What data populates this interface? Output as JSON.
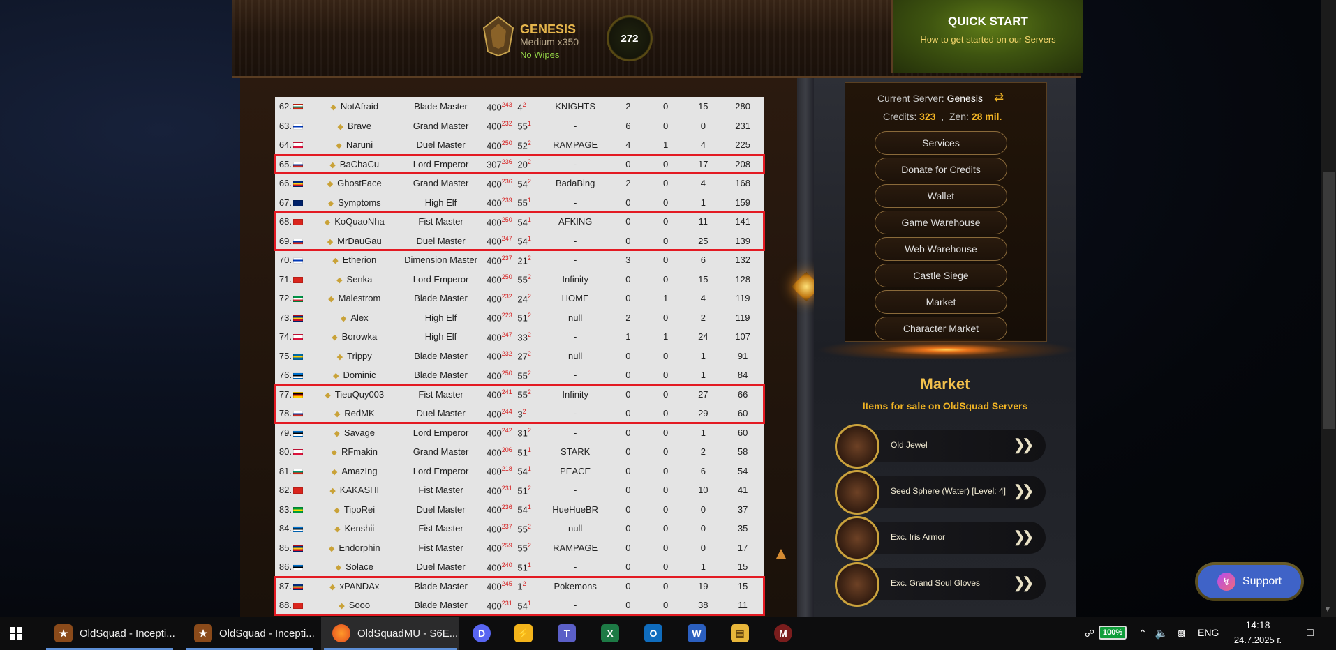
{
  "header": {
    "server_name": "GENESIS",
    "server_rate": "Medium x350",
    "server_wipe": "No Wipes",
    "online_count": "272",
    "quick_start_title": "QUICK START",
    "quick_start_sub": "How to get started on our Servers"
  },
  "ranking": {
    "rows": [
      {
        "rank": "62.",
        "flag": "bg",
        "name": "NotAfraid",
        "cls": "Blade Master",
        "reset": "400",
        "reset_sup": "243",
        "gr": "4",
        "gr_sup": "2",
        "guild": "KNIGHTS",
        "n1": "2",
        "n2": "0",
        "n3": "15",
        "score": "280"
      },
      {
        "rank": "63.",
        "flag": "il",
        "name": "Brave",
        "cls": "Grand Master",
        "reset": "400",
        "reset_sup": "232",
        "gr": "55",
        "gr_sup": "1",
        "guild": "-",
        "n1": "6",
        "n2": "0",
        "n3": "0",
        "score": "231"
      },
      {
        "rank": "64.",
        "flag": "pl",
        "name": "Naruni",
        "cls": "Duel Master",
        "reset": "400",
        "reset_sup": "250",
        "gr": "52",
        "gr_sup": "2",
        "guild": "RAMPAGE",
        "n1": "4",
        "n2": "1",
        "n3": "4",
        "score": "225"
      },
      {
        "rank": "65.",
        "flag": "ru",
        "name": "BaChaCu",
        "cls": "Lord Emperor",
        "reset": "307",
        "reset_sup": "236",
        "gr": "20",
        "gr_sup": "2",
        "guild": "-",
        "n1": "0",
        "n2": "0",
        "n3": "17",
        "score": "208"
      },
      {
        "rank": "66.",
        "flag": "ro",
        "name": "GhostFace",
        "cls": "Grand Master",
        "reset": "400",
        "reset_sup": "236",
        "gr": "54",
        "gr_sup": "2",
        "guild": "BadaBing",
        "n1": "2",
        "n2": "0",
        "n3": "4",
        "score": "168"
      },
      {
        "rank": "67.",
        "flag": "au",
        "name": "Symptoms",
        "cls": "High Elf",
        "reset": "400",
        "reset_sup": "239",
        "gr": "55",
        "gr_sup": "1",
        "guild": "-",
        "n1": "0",
        "n2": "0",
        "n3": "1",
        "score": "159"
      },
      {
        "rank": "68.",
        "flag": "vn",
        "name": "KoQuaoNha",
        "cls": "Fist Master",
        "reset": "400",
        "reset_sup": "250",
        "gr": "54",
        "gr_sup": "1",
        "guild": "AFKING",
        "n1": "0",
        "n2": "0",
        "n3": "11",
        "score": "141"
      },
      {
        "rank": "69.",
        "flag": "ru",
        "name": "MrDauGau",
        "cls": "Duel Master",
        "reset": "400",
        "reset_sup": "247",
        "gr": "54",
        "gr_sup": "1",
        "guild": "-",
        "n1": "0",
        "n2": "0",
        "n3": "25",
        "score": "139"
      },
      {
        "rank": "70.",
        "flag": "il",
        "name": "Etherion",
        "cls": "Dimension Master",
        "reset": "400",
        "reset_sup": "237",
        "gr": "21",
        "gr_sup": "2",
        "guild": "-",
        "n1": "3",
        "n2": "0",
        "n3": "6",
        "score": "132"
      },
      {
        "rank": "71.",
        "flag": "vn",
        "name": "Senka",
        "cls": "Lord Emperor",
        "reset": "400",
        "reset_sup": "250",
        "gr": "55",
        "gr_sup": "2",
        "guild": "Infinity",
        "n1": "0",
        "n2": "0",
        "n3": "15",
        "score": "128"
      },
      {
        "rank": "72.",
        "flag": "it",
        "name": "Malestrom",
        "cls": "Blade Master",
        "reset": "400",
        "reset_sup": "232",
        "gr": "24",
        "gr_sup": "2",
        "guild": "HOME",
        "n1": "0",
        "n2": "1",
        "n3": "4",
        "score": "119"
      },
      {
        "rank": "73.",
        "flag": "ro",
        "name": "Alex",
        "cls": "High Elf",
        "reset": "400",
        "reset_sup": "223",
        "gr": "51",
        "gr_sup": "2",
        "guild": "null",
        "n1": "2",
        "n2": "0",
        "n3": "2",
        "score": "119"
      },
      {
        "rank": "74.",
        "flag": "pl",
        "name": "Borowka",
        "cls": "High Elf",
        "reset": "400",
        "reset_sup": "247",
        "gr": "33",
        "gr_sup": "2",
        "guild": "-",
        "n1": "1",
        "n2": "1",
        "n3": "24",
        "score": "107"
      },
      {
        "rank": "75.",
        "flag": "se",
        "name": "Trippy",
        "cls": "Blade Master",
        "reset": "400",
        "reset_sup": "232",
        "gr": "27",
        "gr_sup": "2",
        "guild": "null",
        "n1": "0",
        "n2": "0",
        "n3": "1",
        "score": "91"
      },
      {
        "rank": "76.",
        "flag": "ee",
        "name": "Dominic",
        "cls": "Blade Master",
        "reset": "400",
        "reset_sup": "250",
        "gr": "55",
        "gr_sup": "2",
        "guild": "-",
        "n1": "0",
        "n2": "0",
        "n3": "1",
        "score": "84"
      },
      {
        "rank": "77.",
        "flag": "de",
        "name": "TieuQuy003",
        "cls": "Fist Master",
        "reset": "400",
        "reset_sup": "241",
        "gr": "55",
        "gr_sup": "2",
        "guild": "Infinity",
        "n1": "0",
        "n2": "0",
        "n3": "27",
        "score": "66"
      },
      {
        "rank": "78.",
        "flag": "ru",
        "name": "RedMK",
        "cls": "Duel Master",
        "reset": "400",
        "reset_sup": "244",
        "gr": "3",
        "gr_sup": "2",
        "guild": "-",
        "n1": "0",
        "n2": "0",
        "n3": "29",
        "score": "60"
      },
      {
        "rank": "79.",
        "flag": "ee",
        "name": "Savage",
        "cls": "Lord Emperor",
        "reset": "400",
        "reset_sup": "242",
        "gr": "31",
        "gr_sup": "2",
        "guild": "-",
        "n1": "0",
        "n2": "0",
        "n3": "1",
        "score": "60"
      },
      {
        "rank": "80.",
        "flag": "pl",
        "name": "RFmakin",
        "cls": "Grand Master",
        "reset": "400",
        "reset_sup": "206",
        "gr": "51",
        "gr_sup": "1",
        "guild": "STARK",
        "n1": "0",
        "n2": "0",
        "n3": "2",
        "score": "58"
      },
      {
        "rank": "81.",
        "flag": "bg",
        "name": "AmazIng",
        "cls": "Lord Emperor",
        "reset": "400",
        "reset_sup": "218",
        "gr": "54",
        "gr_sup": "1",
        "guild": "PEACE",
        "n1": "0",
        "n2": "0",
        "n3": "6",
        "score": "54"
      },
      {
        "rank": "82.",
        "flag": "vn",
        "name": "KAKASHI",
        "cls": "Fist Master",
        "reset": "400",
        "reset_sup": "231",
        "gr": "51",
        "gr_sup": "2",
        "guild": "-",
        "n1": "0",
        "n2": "0",
        "n3": "10",
        "score": "41"
      },
      {
        "rank": "83.",
        "flag": "br",
        "name": "TipoRei",
        "cls": "Duel Master",
        "reset": "400",
        "reset_sup": "236",
        "gr": "54",
        "gr_sup": "1",
        "guild": "HueHueBR",
        "n1": "0",
        "n2": "0",
        "n3": "0",
        "score": "37"
      },
      {
        "rank": "84.",
        "flag": "ee",
        "name": "Kenshii",
        "cls": "Fist Master",
        "reset": "400",
        "reset_sup": "237",
        "gr": "55",
        "gr_sup": "2",
        "guild": "null",
        "n1": "0",
        "n2": "0",
        "n3": "0",
        "score": "35"
      },
      {
        "rank": "85.",
        "flag": "ro",
        "name": "Endorphin",
        "cls": "Fist Master",
        "reset": "400",
        "reset_sup": "259",
        "gr": "55",
        "gr_sup": "2",
        "guild": "RAMPAGE",
        "n1": "0",
        "n2": "0",
        "n3": "0",
        "score": "17"
      },
      {
        "rank": "86.",
        "flag": "ee",
        "name": "Solace",
        "cls": "Duel Master",
        "reset": "400",
        "reset_sup": "240",
        "gr": "51",
        "gr_sup": "1",
        "guild": "-",
        "n1": "0",
        "n2": "0",
        "n3": "1",
        "score": "15"
      },
      {
        "rank": "87.",
        "flag": "ro",
        "name": "xPANDAx",
        "cls": "Blade Master",
        "reset": "400",
        "reset_sup": "245",
        "gr": "1",
        "gr_sup": "2",
        "guild": "Pokemons",
        "n1": "0",
        "n2": "0",
        "n3": "19",
        "score": "15"
      },
      {
        "rank": "88.",
        "flag": "vn",
        "name": "Sooo",
        "cls": "Blade Master",
        "reset": "400",
        "reset_sup": "231",
        "gr": "54",
        "gr_sup": "1",
        "guild": "-",
        "n1": "0",
        "n2": "0",
        "n3": "38",
        "score": "11"
      }
    ],
    "highlight_color": "#e31a23"
  },
  "sidebar": {
    "current_server_label": "Current Server:",
    "current_server_value": "Genesis",
    "credits_label": "Credits:",
    "credits_value": "323",
    "zen_label": "Zen:",
    "zen_value": "28 mil.",
    "buttons": [
      "Services",
      "Donate for Credits",
      "Wallet",
      "Game Warehouse",
      "Web Warehouse",
      "Castle Siege",
      "Market",
      "Character Market"
    ]
  },
  "market": {
    "title": "Market",
    "subtitle": "Items for sale on OldSquad Servers",
    "items": [
      "Old Jewel",
      "Seed Sphere (Water) [Level: 4]",
      "Exc. Iris Armor",
      "Exc. Grand Soul Gloves"
    ]
  },
  "support": {
    "label": "Support"
  },
  "taskbar": {
    "apps": [
      "OldSquad - Incepti...",
      "OldSquad - Incepti...",
      "OldSquadMU - S6E..."
    ],
    "battery": "100%",
    "lang": "ENG",
    "time": "14:18",
    "date": "24.7.2025 г."
  },
  "flag_colors": {
    "bg": [
      "#ffffff",
      "#00966e",
      "#d62612"
    ],
    "il": [
      "#ffffff",
      "#0038b8",
      "#ffffff"
    ],
    "pl": [
      "#ffffff",
      "#ffffff",
      "#dc143c"
    ],
    "ru": [
      "#ffffff",
      "#0039a6",
      "#d52b1e"
    ],
    "ro": [
      "#002b7f",
      "#fcd116",
      "#ce1126"
    ],
    "au": [
      "#012169",
      "#012169",
      "#012169"
    ],
    "vn": [
      "#da251d",
      "#da251d",
      "#da251d"
    ],
    "it": [
      "#009246",
      "#ffffff",
      "#ce2b37"
    ],
    "se": [
      "#006aa7",
      "#fecc00",
      "#006aa7"
    ],
    "ee": [
      "#0072ce",
      "#000000",
      "#ffffff"
    ],
    "de": [
      "#000000",
      "#dd0000",
      "#ffce00"
    ],
    "br": [
      "#009c3b",
      "#ffdf00",
      "#009c3b"
    ]
  }
}
